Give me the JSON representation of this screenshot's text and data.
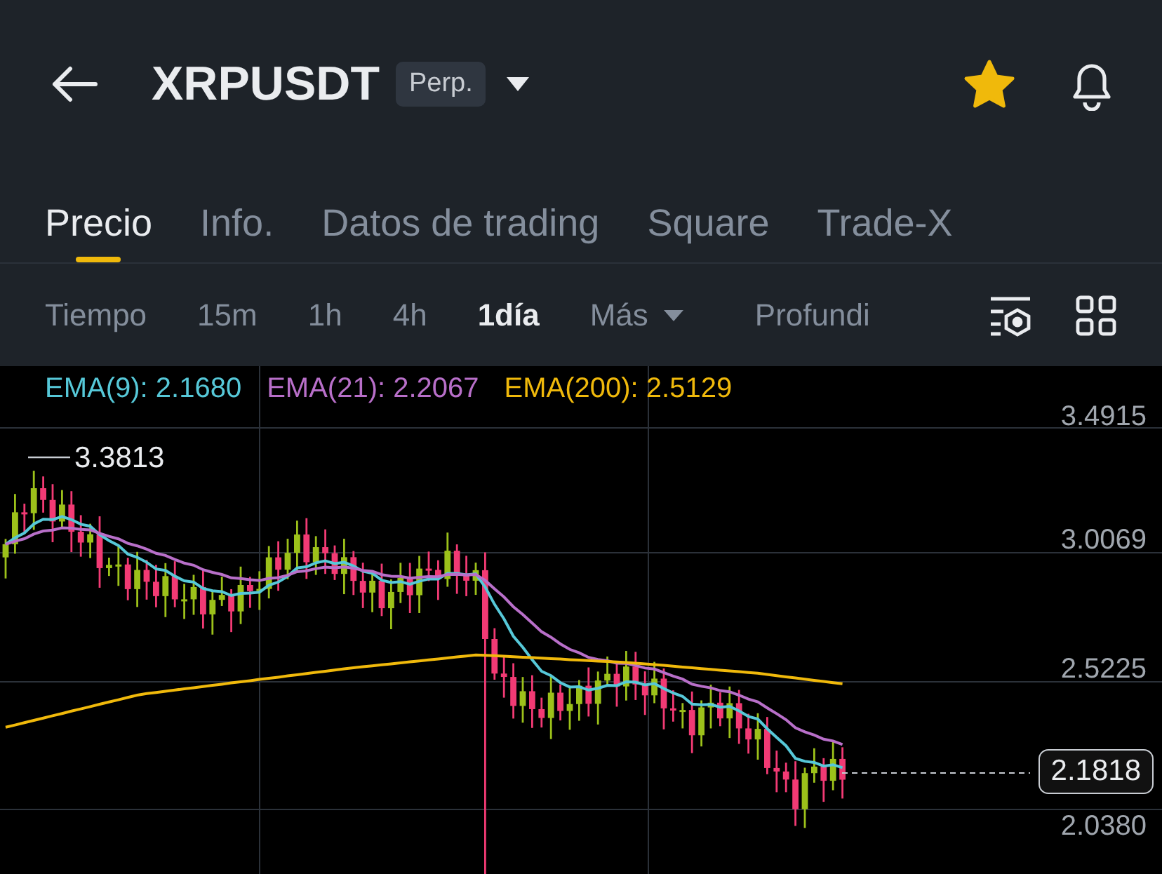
{
  "header": {
    "symbol": "XRPUSDT",
    "badge": "Perp.",
    "favorite": true
  },
  "tabs": [
    {
      "label": "Precio",
      "selected": true
    },
    {
      "label": "Info.",
      "selected": false
    },
    {
      "label": "Datos de trading",
      "selected": false
    },
    {
      "label": "Square",
      "selected": false
    },
    {
      "label": "Trade-X",
      "selected": false
    }
  ],
  "intervals": [
    {
      "label": "Tiempo",
      "kind": "plain",
      "selected": false
    },
    {
      "label": "15m",
      "kind": "plain",
      "selected": false
    },
    {
      "label": "1h",
      "kind": "plain",
      "selected": false
    },
    {
      "label": "4h",
      "kind": "plain",
      "selected": false
    },
    {
      "label": "1día",
      "kind": "plain",
      "selected": true
    },
    {
      "label": "Más",
      "kind": "menu",
      "selected": false
    },
    {
      "label": "Profundi",
      "kind": "plain",
      "selected": false
    }
  ],
  "chart": {
    "indicators": [
      {
        "label": "EMA(9): 2.1680",
        "color": "#56c8d8"
      },
      {
        "label": "EMA(21): 2.2067",
        "color": "#b86fc9"
      },
      {
        "label": "EMA(200): 2.5129",
        "color": "#f0b90b"
      }
    ],
    "price_axis": [
      "3.4915",
      "3.0069",
      "2.5225",
      "2.0380"
    ],
    "high_label": "3.3813",
    "last_price": "2.1818"
  }
}
